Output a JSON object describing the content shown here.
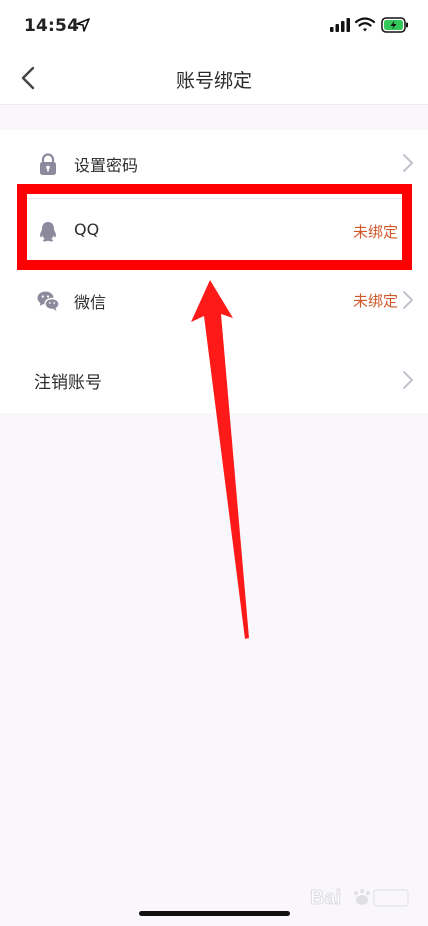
{
  "status_bar": {
    "time": "14:54"
  },
  "nav": {
    "title": "账号绑定"
  },
  "bindings": [
    {
      "label": "设置密码",
      "status": "",
      "icon": "lock-icon"
    },
    {
      "label": "QQ",
      "status": "未绑定",
      "icon": "qq-penguin-icon"
    },
    {
      "label": "微信",
      "status": "未绑定",
      "icon": "wechat-icon"
    }
  ],
  "account": {
    "cancel_label": "注销账号"
  },
  "colors": {
    "accent_status": "#d0572a",
    "annotation": "#ff0000",
    "icon_gray": "#8c8a9c"
  }
}
